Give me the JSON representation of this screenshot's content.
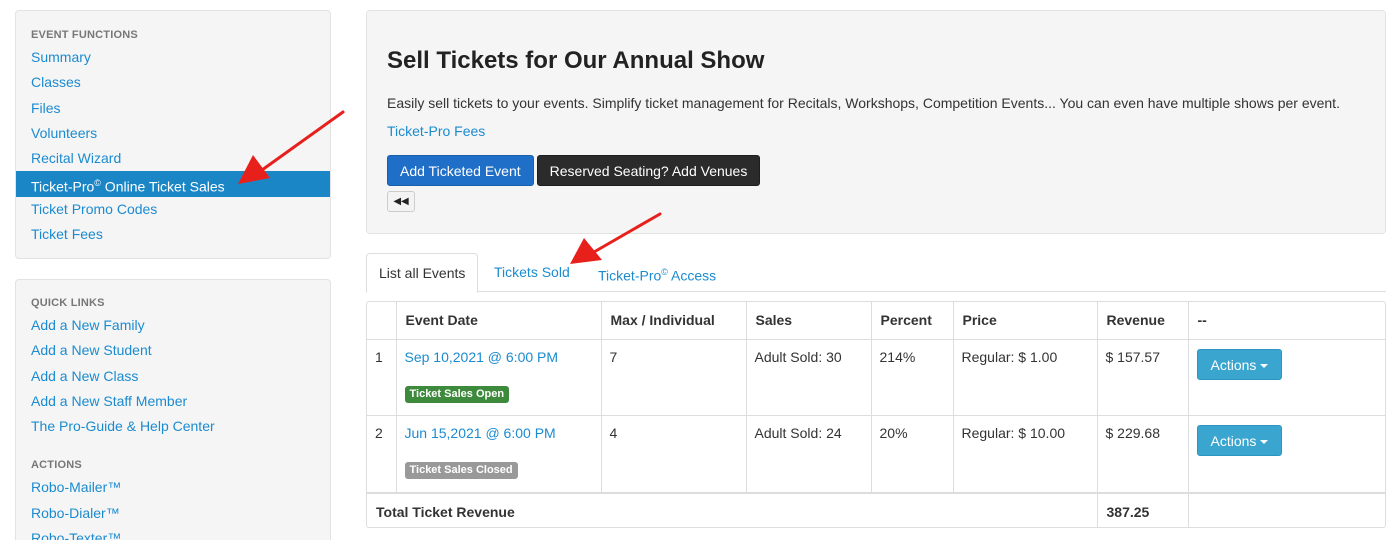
{
  "sidebar": {
    "event_functions": {
      "heading": "EVENT FUNCTIONS",
      "items": [
        {
          "label": "Summary"
        },
        {
          "label": "Classes"
        },
        {
          "label": "Files"
        },
        {
          "label": "Volunteers"
        },
        {
          "label": "Recital Wizard"
        },
        {
          "label": "Ticket-Pro",
          "sup": "©",
          "suffix": " Online Ticket Sales"
        },
        {
          "label": "Ticket Promo Codes"
        },
        {
          "label": "Ticket Fees"
        }
      ]
    },
    "quick_links": {
      "heading": "QUICK LINKS",
      "items": [
        {
          "label": "Add a New Family"
        },
        {
          "label": "Add a New Student"
        },
        {
          "label": "Add a New Class"
        },
        {
          "label": "Add a New Staff Member"
        },
        {
          "label": "The Pro-Guide & Help Center"
        }
      ]
    },
    "actions": {
      "heading": "ACTIONS",
      "items": [
        {
          "label": "Robo-Mailer™"
        },
        {
          "label": "Robo-Dialer™"
        },
        {
          "label": "Robo-Texter™"
        }
      ]
    }
  },
  "header": {
    "title": "Sell Tickets for Our Annual Show",
    "description": "Easily sell tickets to your events. Simplify ticket management for Recitals, Workshops, Competition Events... You can even have multiple shows per event.",
    "fees_link": "Ticket-Pro Fees",
    "add_button": "Add Ticketed Event",
    "venues_button": "Reserved Seating? Add Venues",
    "back_glyph": "◀◀"
  },
  "tabs": {
    "list": "List all Events",
    "sold": "Tickets Sold",
    "access": "Ticket-Pro",
    "access_sup": "©",
    "access_suffix": " Access"
  },
  "table": {
    "headers": [
      "",
      "Event Date",
      "Max / Individual",
      "Sales",
      "Percent",
      "Price",
      "Revenue",
      "--"
    ],
    "rows": [
      {
        "num": "1",
        "date": "Sep 10,2021 @ 6:00 PM",
        "status": "Ticket Sales Open",
        "max": "7",
        "sales": "Adult Sold: 30",
        "percent": "214%",
        "price": "Regular: $ 1.00",
        "revenue": "$ 157.57",
        "action": "Actions"
      },
      {
        "num": "2",
        "date": "Jun 15,2021 @ 6:00 PM",
        "status": "Ticket Sales Closed",
        "max": "4",
        "sales": "Adult Sold: 24",
        "percent": "20%",
        "price": "Regular: $ 10.00",
        "revenue": "$ 229.68",
        "action": "Actions"
      }
    ],
    "total_label": "Total Ticket Revenue",
    "total_value": "387.25"
  },
  "colors": {
    "link": "#1b8bd0",
    "active_nav": "#1b86c6",
    "status_open": "#3d8a3d",
    "status_closed": "#999999",
    "annotation_arrow": "#e8201c"
  }
}
